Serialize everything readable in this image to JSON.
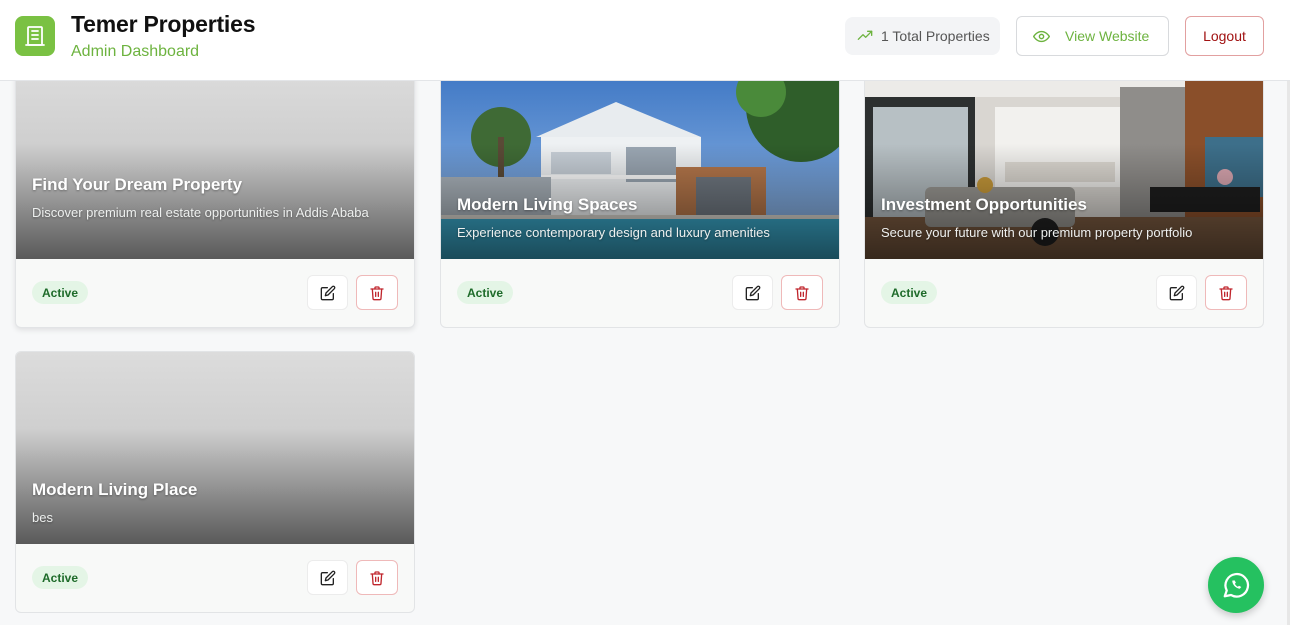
{
  "header": {
    "title": "Temer Properties",
    "subtitle": "Admin Dashboard",
    "total_label": "1 Total Properties",
    "view_label": "View Website",
    "logout_label": "Logout",
    "logo_icon": "building-icon",
    "accent": "#7ac143"
  },
  "cards": [
    {
      "title": "Find Your Dream Property",
      "description": "Discover premium real estate opportunities in Addis Ababa",
      "status": "Active",
      "image": "none"
    },
    {
      "title": "Modern Living Spaces",
      "description": "Experience contemporary design and luxury amenities",
      "status": "Active",
      "image": "white-house-with-pool-and-palms"
    },
    {
      "title": "Investment Opportunities",
      "description": "Secure your future with our premium property portfolio",
      "status": "Active",
      "image": "modern-interior-living-room-and-kitchen"
    },
    {
      "title": "Modern Living Place",
      "description": "bes",
      "status": "Active",
      "image": "none"
    }
  ],
  "icons": {
    "edit": "edit-icon",
    "delete": "trash-icon",
    "whatsapp": "whatsapp-icon",
    "trend": "trending-up-icon",
    "eye": "eye-icon"
  }
}
